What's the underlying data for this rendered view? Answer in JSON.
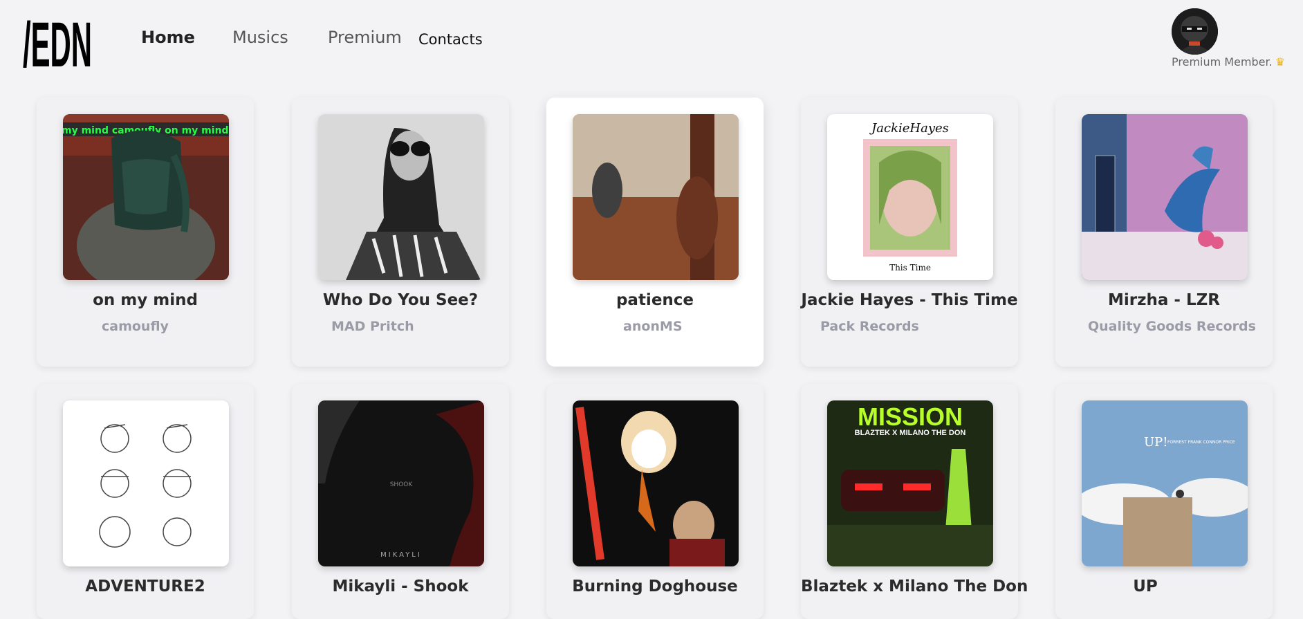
{
  "header": {
    "logo_text": "/EDN",
    "nav": {
      "home": "Home",
      "musics": "Musics",
      "premium": "Premium",
      "contacts": "Contacts"
    },
    "member_label": "Premium Member.",
    "crown_icon": "crown-icon"
  },
  "tracks": [
    {
      "title": "on my mind",
      "artist": "camoufly"
    },
    {
      "title": "Who Do You See?",
      "artist": "MAD Pritch"
    },
    {
      "title": "patience",
      "artist": "anonMS"
    },
    {
      "title": "Jackie Hayes - This Time",
      "artist": "Pack Records"
    },
    {
      "title": "Mirzha - LZR",
      "artist": "Quality Goods Records"
    },
    {
      "title": "ADVENTURE2",
      "artist": ""
    },
    {
      "title": "Mikayli - Shook",
      "artist": ""
    },
    {
      "title": "Burning Doghouse",
      "artist": ""
    },
    {
      "title": "Blaztek x Milano The Don",
      "artist": ""
    },
    {
      "title": "UP",
      "artist": ""
    }
  ],
  "cover_text": {
    "on_my_mind_banner": "my mind camoufly on my mind camou",
    "jackie_top": "JackieHayes",
    "jackie_bottom": "This Time",
    "shook_center": "SHOOK",
    "shook_bottom": "MIKAYLI",
    "mission_top": "MISSION",
    "mission_sub": "BLAZTEK X MILANO THE DON",
    "up_title": "UP!",
    "up_sub": "FORREST FRANK CONNOR PRICE"
  },
  "colors": {
    "background": "#f3f2f4",
    "card": "#f1f1f4",
    "card_active": "#ffffff",
    "artist_text": "#9a9ba6",
    "crown": "#e6b422"
  }
}
